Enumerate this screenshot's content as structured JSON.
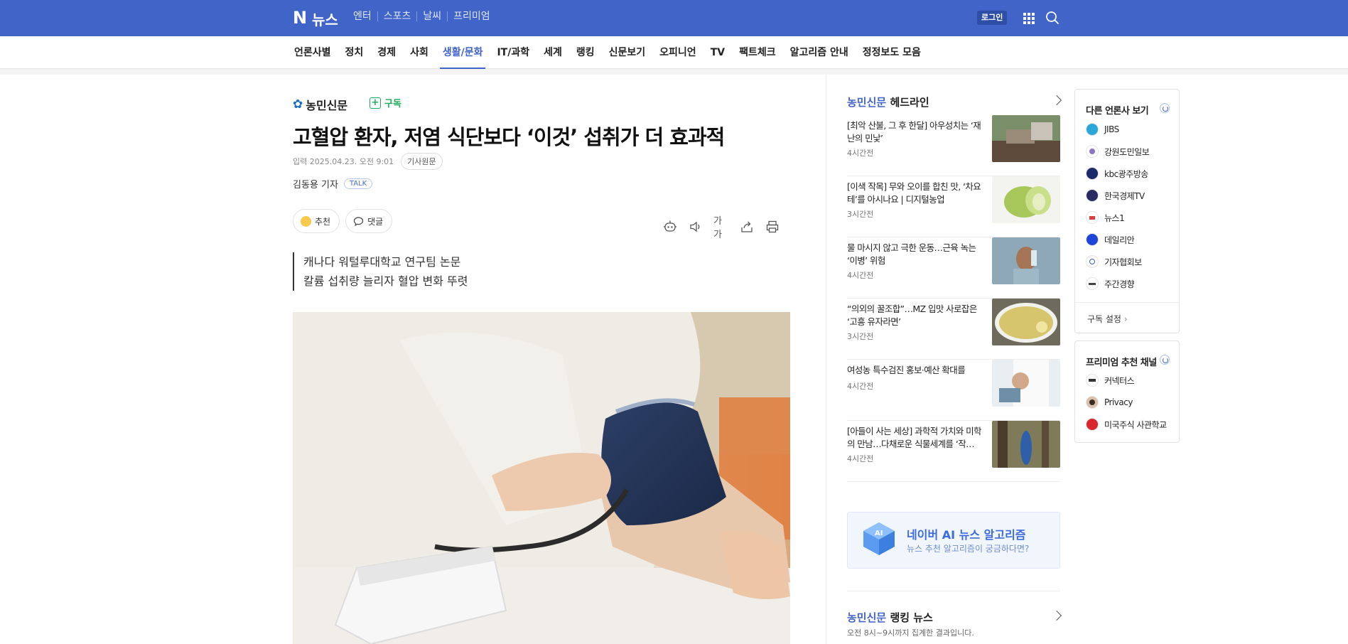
{
  "topbar": {
    "logo_letter": "N",
    "logo_text": "뉴스",
    "nav": [
      "엔터",
      "스포츠",
      "날씨",
      "프리미엄"
    ],
    "login_label": "로그인"
  },
  "categories": [
    "언론사별",
    "정치",
    "경제",
    "사회",
    "생활/문화",
    "IT/과학",
    "세계",
    "랭킹",
    "신문보기",
    "오피니언",
    "TV",
    "팩트체크",
    "알고리즘 안내",
    "정정보도 모음"
  ],
  "active_category": "생활/문화",
  "article": {
    "press_name": "농민신문",
    "subscribe_label": "구독",
    "headline": "고혈압 환자, 저염 식단보다 ‘이것’ 섭취가 더 효과적",
    "dateline": "입력 2025.04.23. 오전 9:01",
    "original_label": "기사원문",
    "reporter": "김동용 기자",
    "talk_label": "TALK",
    "recommend_label": "추천",
    "comment_label": "댓글",
    "font_size_label": "가가",
    "summary": [
      "캐나다 워털루대학교 연구팀 논문",
      "칼륨 섭취량 늘리자 혈압 변화 뚜렷"
    ]
  },
  "sidebar": {
    "press_highlight": "농민신문",
    "headline_suffix": "헤드라인",
    "headlines": [
      {
        "title": "[최악 산불, 그 후 한달] 아우성치는 ‘재난의 민낯’",
        "time": "4시간전"
      },
      {
        "title": "[이색 작목] 무와 오이를 합친 맛, ‘차요테’를 아시나요 | 디지털농업",
        "time": "3시간전"
      },
      {
        "title": "물 마시지 않고 극한 운동…근육 녹는 ‘이병’ 위험",
        "time": "4시간전"
      },
      {
        "title": "“의외의 꿀조합”…MZ 입맛 사로잡은 ‘고흥 유자라면’",
        "time": "3시간전"
      },
      {
        "title": "여성농 특수검진 홍보·예산 확대를",
        "time": "4시간전"
      },
      {
        "title": "[아들이 사는 세상] 과학적 가치와 미학의 만남…다채로운 식물세계를 ‘작…",
        "time": "4시간전"
      }
    ],
    "ai_title": "네이버 AI 뉴스 알고리즘",
    "ai_sub": "뉴스 추천 알고리즘이 궁금하다면?",
    "ai_badge": "AI",
    "ranking_suffix": "랭킹 뉴스",
    "ranking_sub": "오전 8시~9시까지 집계한 결과입니다."
  },
  "other_press": {
    "title": "다른 언론사 보기",
    "items": [
      "JIBS",
      "강원도민일보",
      "kbc광주방송",
      "한국경제TV",
      "뉴스1",
      "데일리안",
      "기자협회보",
      "주간경향"
    ],
    "setting_label": "구독 설정"
  },
  "premium": {
    "title": "프리미엄 추천 채널",
    "items": [
      "커넥터스",
      "Privacy",
      "미국주식 사관학교"
    ]
  },
  "colors": {
    "brand": "#4064c7",
    "subscribe": "#1faa5a"
  }
}
